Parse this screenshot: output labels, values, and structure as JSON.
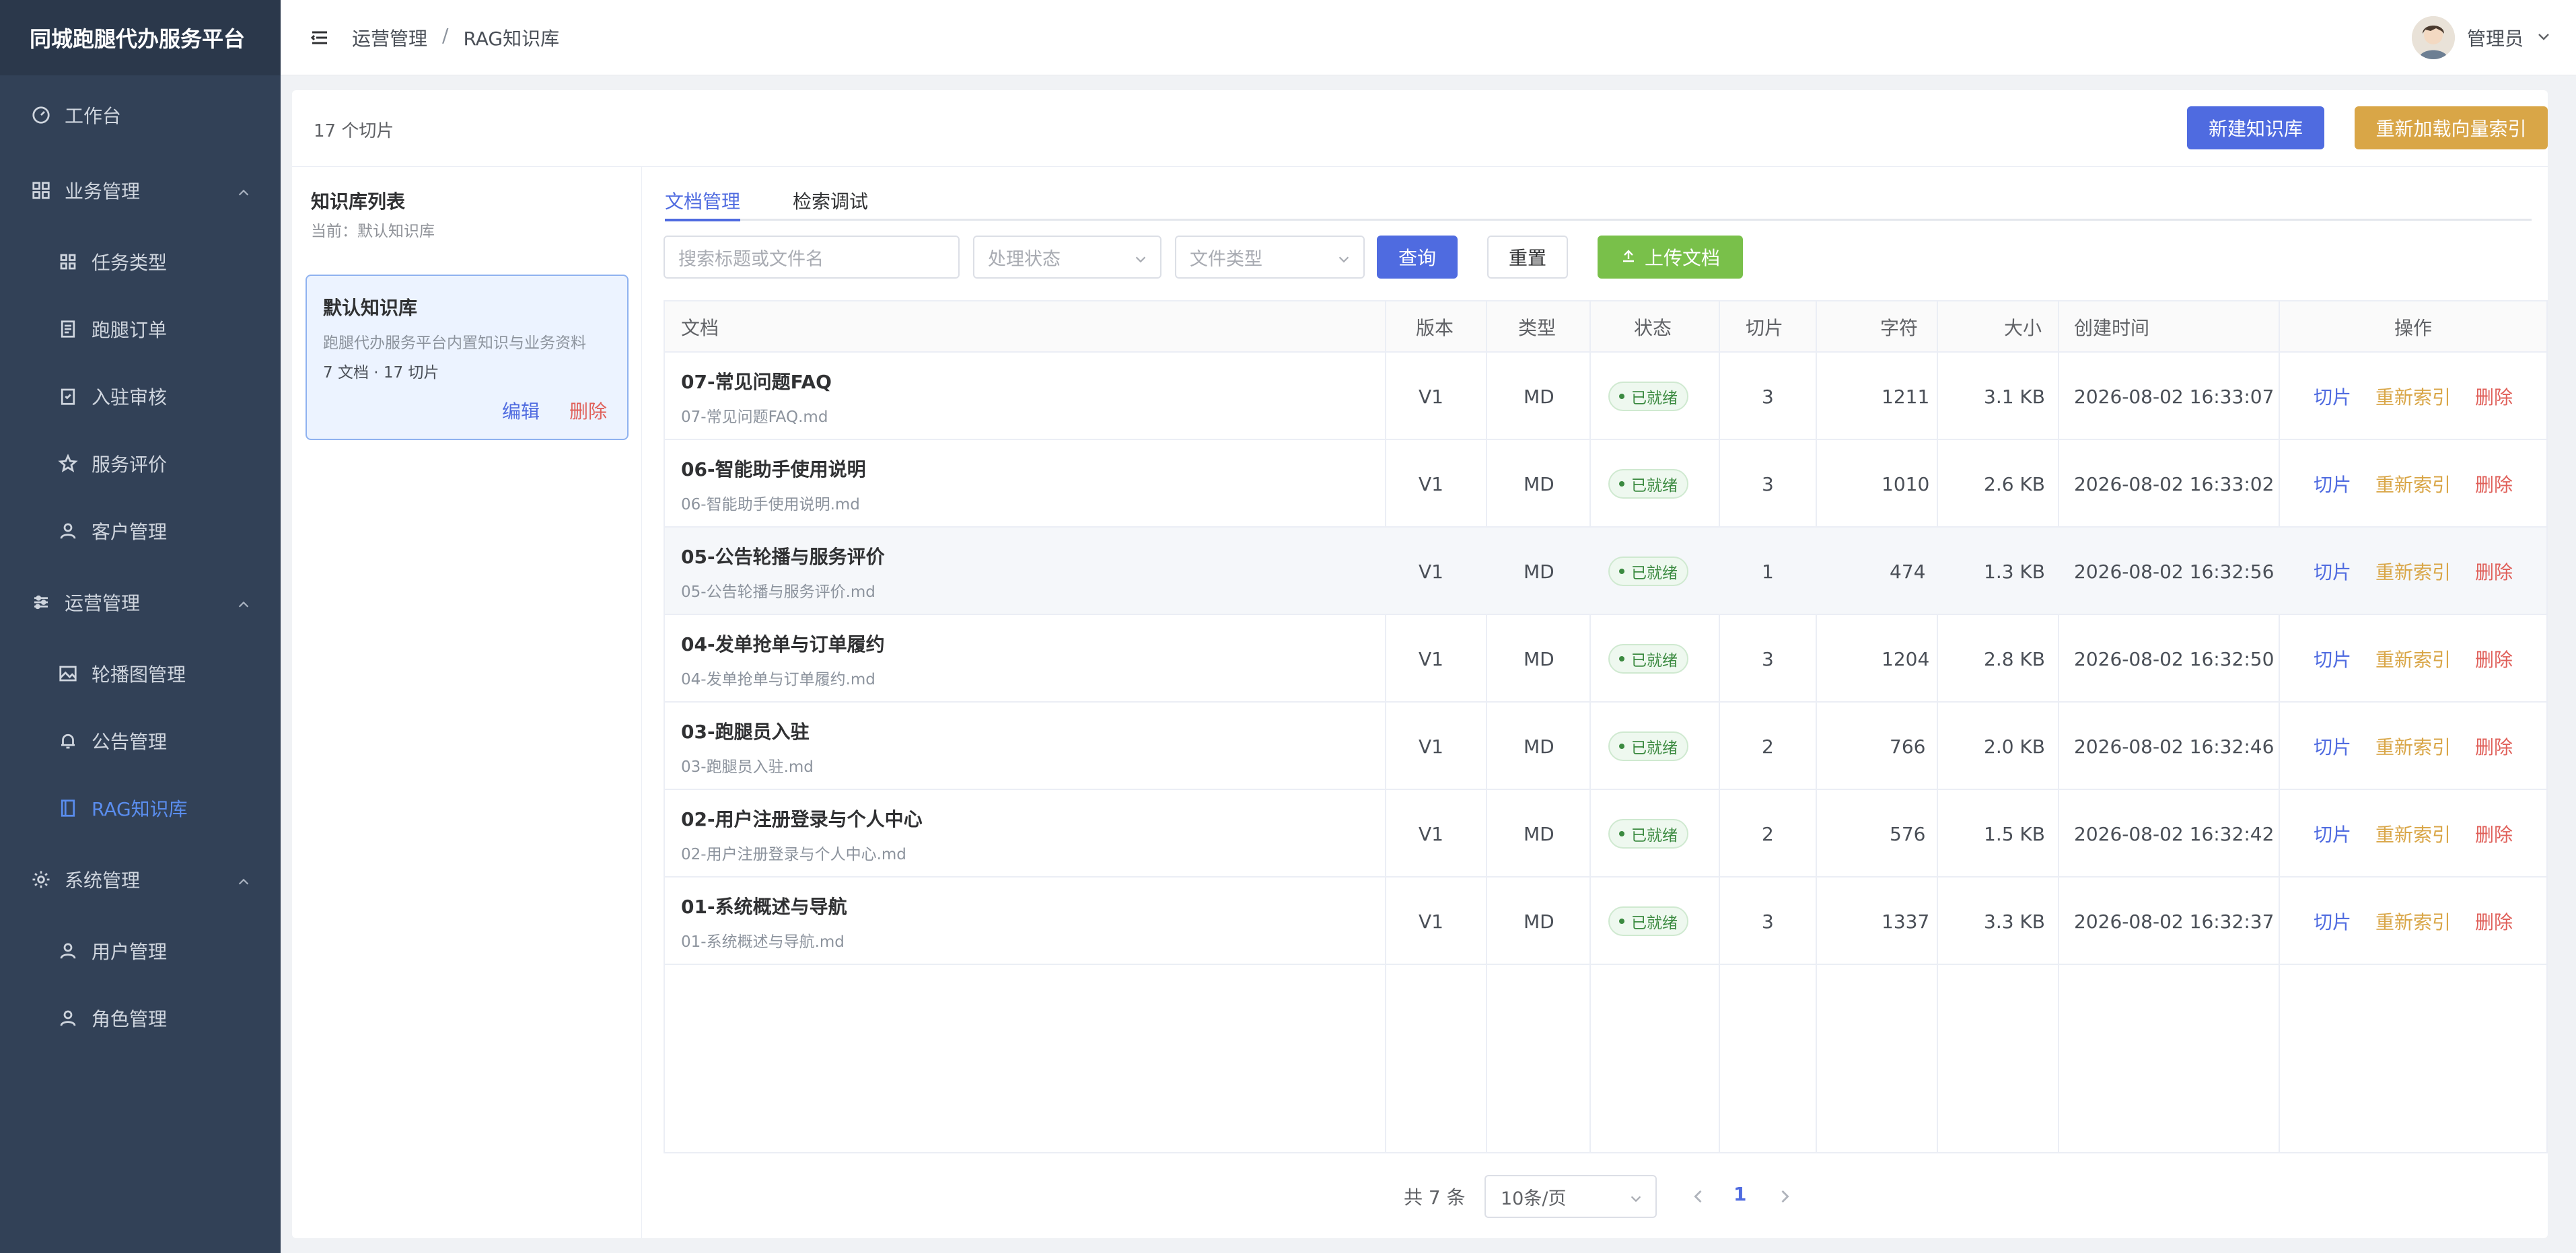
{
  "app": {
    "brand": "同城跑腿代办服务平台"
  },
  "sidebar": {
    "items": [
      {
        "label": "工作台",
        "icon": "dashboard-icon"
      },
      {
        "label": "业务管理",
        "icon": "grid-icon"
      },
      {
        "label": "任务类型",
        "icon": "apps-icon"
      },
      {
        "label": "跑腿订单",
        "icon": "document-icon"
      },
      {
        "label": "入驻审核",
        "icon": "check-clipboard-icon"
      },
      {
        "label": "服务评价",
        "icon": "star-icon"
      },
      {
        "label": "客户管理",
        "icon": "user-icon"
      },
      {
        "label": "运营管理",
        "icon": "sliders-icon"
      },
      {
        "label": "轮播图管理",
        "icon": "image-icon"
      },
      {
        "label": "公告管理",
        "icon": "bell-icon"
      },
      {
        "label": "RAG知识库",
        "icon": "book-icon"
      },
      {
        "label": "系统管理",
        "icon": "gear-icon"
      },
      {
        "label": "用户管理",
        "icon": "user-icon"
      },
      {
        "label": "角色管理",
        "icon": "user-role-icon"
      }
    ],
    "active_color": "#5a8dee"
  },
  "header": {
    "breadcrumb": [
      "运营管理",
      "RAG知识库"
    ],
    "separator": "/",
    "username": "管理员"
  },
  "toolbar": {
    "chunk_count": "17 个切片",
    "new_kb": "新建知识库",
    "reload_index": "重新加载向量索引"
  },
  "kb_panel": {
    "title": "知识库列表",
    "current": "当前：默认知识库",
    "card": {
      "name": "默认知识库",
      "desc": "跑腿代办服务平台内置知识与业务资料",
      "stats": "7 文档 · 17 切片",
      "edit": "编辑",
      "delete": "删除"
    }
  },
  "tabs": [
    {
      "label": "文档管理",
      "active": true
    },
    {
      "label": "检索调试",
      "active": false
    }
  ],
  "filters": {
    "search_placeholder": "搜索标题或文件名",
    "status_placeholder": "处理状态",
    "type_placeholder": "文件类型",
    "query": "查询",
    "reset": "重置",
    "upload": "上传文档"
  },
  "table": {
    "columns": [
      "文档",
      "版本",
      "类型",
      "状态",
      "切片",
      "字符",
      "大小",
      "创建时间",
      "操作"
    ],
    "rows": [
      {
        "title": "07-常见问题FAQ",
        "file": "07-常见问题FAQ.md",
        "version": "V1",
        "type": "MD",
        "status": "已就绪",
        "chunks": "3",
        "chars": "1211",
        "size": "3.1 KB",
        "created": "2026-08-02 16:33:07"
      },
      {
        "title": "06-智能助手使用说明",
        "file": "06-智能助手使用说明.md",
        "version": "V1",
        "type": "MD",
        "status": "已就绪",
        "chunks": "3",
        "chars": "1010",
        "size": "2.6 KB",
        "created": "2026-08-02 16:33:02"
      },
      {
        "title": "05-公告轮播与服务评价",
        "file": "05-公告轮播与服务评价.md",
        "version": "V1",
        "type": "MD",
        "status": "已就绪",
        "chunks": "1",
        "chars": "474",
        "size": "1.3 KB",
        "created": "2026-08-02 16:32:56"
      },
      {
        "title": "04-发单抢单与订单履约",
        "file": "04-发单抢单与订单履约.md",
        "version": "V1",
        "type": "MD",
        "status": "已就绪",
        "chunks": "3",
        "chars": "1204",
        "size": "2.8 KB",
        "created": "2026-08-02 16:32:50"
      },
      {
        "title": "03-跑腿员入驻",
        "file": "03-跑腿员入驻.md",
        "version": "V1",
        "type": "MD",
        "status": "已就绪",
        "chunks": "2",
        "chars": "766",
        "size": "2.0 KB",
        "created": "2026-08-02 16:32:46"
      },
      {
        "title": "02-用户注册登录与个人中心",
        "file": "02-用户注册登录与个人中心.md",
        "version": "V1",
        "type": "MD",
        "status": "已就绪",
        "chunks": "2",
        "chars": "576",
        "size": "1.5 KB",
        "created": "2026-08-02 16:32:42"
      },
      {
        "title": "01-系统概述与导航",
        "file": "01-系统概述与导航.md",
        "version": "V1",
        "type": "MD",
        "status": "已就绪",
        "chunks": "3",
        "chars": "1337",
        "size": "3.3 KB",
        "created": "2026-08-02 16:32:37"
      }
    ],
    "actions": {
      "cut": "切片",
      "reindex": "重新索引",
      "delete": "删除"
    }
  },
  "pagination": {
    "total": "共 7 条",
    "page_size": "10条/页",
    "current_page": "1"
  }
}
